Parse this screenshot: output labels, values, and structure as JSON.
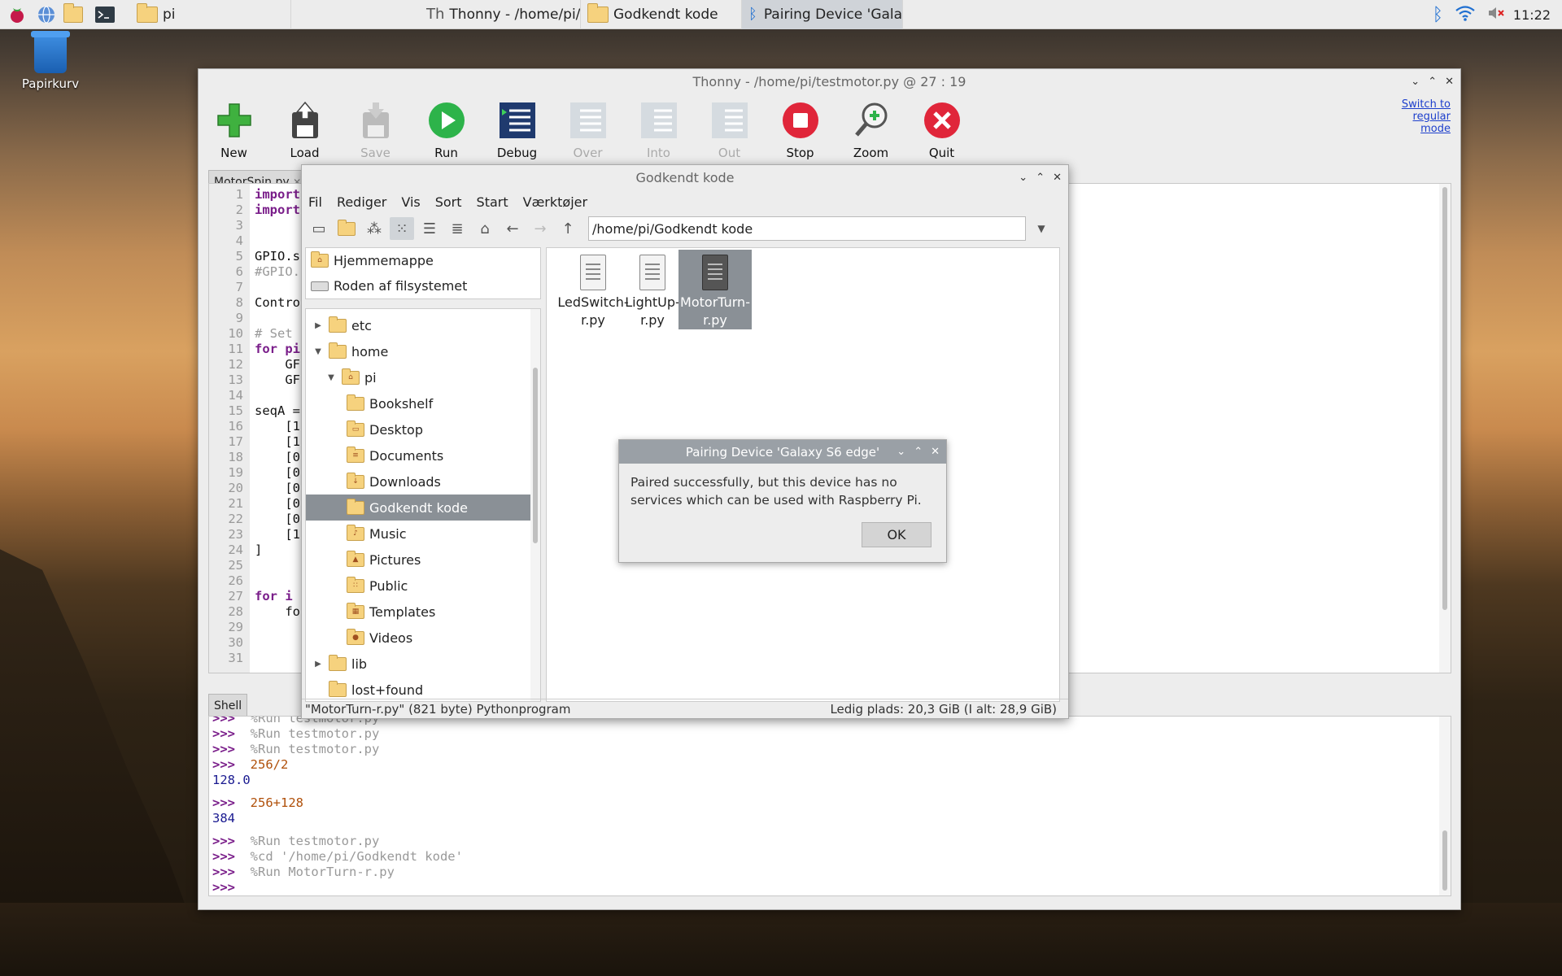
{
  "taskbar": {
    "tasks": [
      "pi",
      "Thonny  -  /home/pi/t...",
      "Godkendt kode",
      "Pairing Device 'Galax..."
    ],
    "clock": "11:22"
  },
  "desktop": {
    "trash_label": "Papirkurv"
  },
  "thonny": {
    "title": "Thonny  -  /home/pi/testmotor.py  @  27 : 19",
    "toolbar": [
      "New",
      "Load",
      "Save",
      "Run",
      "Debug",
      "Over",
      "Into",
      "Out",
      "Stop",
      "Zoom",
      "Quit"
    ],
    "switch_mode": [
      "Switch to",
      "regular",
      "mode"
    ],
    "editor_tab": "MotorSpin.py",
    "shell_tab": "Shell",
    "line_numbers": [
      "1",
      "2",
      "3",
      "4",
      "5",
      "6",
      "7",
      "8",
      "9",
      "10",
      "11",
      "12",
      "13",
      "14",
      "15",
      "16",
      "17",
      "18",
      "19",
      "20",
      "21",
      "22",
      "23",
      "24",
      "25",
      "26",
      "27",
      "28",
      "29",
      "30",
      "31"
    ],
    "code": [
      [
        "import"
      ],
      [
        "import"
      ],
      [
        ""
      ],
      [
        ""
      ],
      [
        "GPIO.s"
      ],
      [
        "#GPIO."
      ],
      [
        ""
      ],
      [
        "Contro"
      ],
      [
        ""
      ],
      [
        "# Set"
      ],
      [
        "for pi"
      ],
      [
        "    GF"
      ],
      [
        "    GF"
      ],
      [
        ""
      ],
      [
        "seqA ="
      ],
      [
        "    [1"
      ],
      [
        "    [1"
      ],
      [
        "    [0"
      ],
      [
        "    [0"
      ],
      [
        "    [0"
      ],
      [
        "    [0"
      ],
      [
        "    [0"
      ],
      [
        "    [1"
      ],
      [
        "]"
      ],
      [
        ""
      ],
      [
        ""
      ],
      [
        "for i"
      ],
      [
        "    fo"
      ],
      [
        ""
      ],
      [
        ""
      ],
      [
        ""
      ]
    ],
    "shell": [
      {
        "p": ">>>",
        "t": "%Run testmotor.py",
        "c": "gray"
      },
      {
        "p": ">>>",
        "t": "%Run testmotor.py",
        "c": "gray"
      },
      {
        "p": ">>>",
        "t": "%Run testmotor.py",
        "c": "gray"
      },
      {
        "p": ">>>",
        "t": "256/2",
        "c": "orange"
      },
      {
        "p": "",
        "t": "128.0",
        "c": "blue"
      },
      {
        "p": "",
        "t": "",
        "c": ""
      },
      {
        "p": ">>>",
        "t": "256+128",
        "c": "orange"
      },
      {
        "p": "",
        "t": "384",
        "c": "blue"
      },
      {
        "p": "",
        "t": "",
        "c": ""
      },
      {
        "p": ">>>",
        "t": "%Run testmotor.py",
        "c": "gray"
      },
      {
        "p": ">>>",
        "t": "%cd '/home/pi/Godkendt kode'",
        "c": "gray"
      },
      {
        "p": ">>>",
        "t": "%Run MotorTurn-r.py",
        "c": "gray"
      },
      {
        "p": ">>>",
        "t": "",
        "c": ""
      }
    ]
  },
  "filemanager": {
    "title": "Godkendt kode",
    "menu": [
      "Fil",
      "Rediger",
      "Vis",
      "Sort",
      "Start",
      "Værktøjer"
    ],
    "path": "/home/pi/Godkendt kode",
    "places": [
      "Hjemmemappe",
      "Roden af filsystemet"
    ],
    "tree": [
      {
        "label": "etc",
        "level": 0,
        "arrow": "▶",
        "icon": ""
      },
      {
        "label": "home",
        "level": 0,
        "arrow": "▼",
        "icon": ""
      },
      {
        "label": "pi",
        "level": 1,
        "arrow": "▼",
        "icon": "⌂"
      },
      {
        "label": "Bookshelf",
        "level": 2,
        "arrow": "",
        "icon": ""
      },
      {
        "label": "Desktop",
        "level": 2,
        "arrow": "",
        "icon": "▭"
      },
      {
        "label": "Documents",
        "level": 2,
        "arrow": "",
        "icon": "≡"
      },
      {
        "label": "Downloads",
        "level": 2,
        "arrow": "",
        "icon": "↓"
      },
      {
        "label": "Godkendt kode",
        "level": 2,
        "arrow": "",
        "icon": "",
        "selected": true
      },
      {
        "label": "Music",
        "level": 2,
        "arrow": "",
        "icon": "♪"
      },
      {
        "label": "Pictures",
        "level": 2,
        "arrow": "",
        "icon": "▲"
      },
      {
        "label": "Public",
        "level": 2,
        "arrow": "",
        "icon": "∷"
      },
      {
        "label": "Templates",
        "level": 2,
        "arrow": "",
        "icon": "▦"
      },
      {
        "label": "Videos",
        "level": 2,
        "arrow": "",
        "icon": "●"
      },
      {
        "label": "lib",
        "level": 0,
        "arrow": "▶",
        "icon": ""
      },
      {
        "label": "lost+found",
        "level": 0,
        "arrow": "",
        "icon": ""
      }
    ],
    "files": [
      {
        "name1": "LedSwitch-",
        "name2": "r.py",
        "selected": false
      },
      {
        "name1": "LightUp-r.py",
        "name2": "",
        "selected": false
      },
      {
        "name1": "MotorTurn-",
        "name2": "r.py",
        "selected": true
      }
    ],
    "status_left": "\"MotorTurn-r.py\" (821 byte) Pythonprogram",
    "status_right": "Ledig plads: 20,3 GiB (I alt: 28,9 GiB)"
  },
  "dialog": {
    "title": "Pairing Device 'Galaxy S6 edge'",
    "line1": "Paired successfully, but this device has no",
    "line2": "services which can be used with Raspberry Pi.",
    "ok": "OK"
  }
}
